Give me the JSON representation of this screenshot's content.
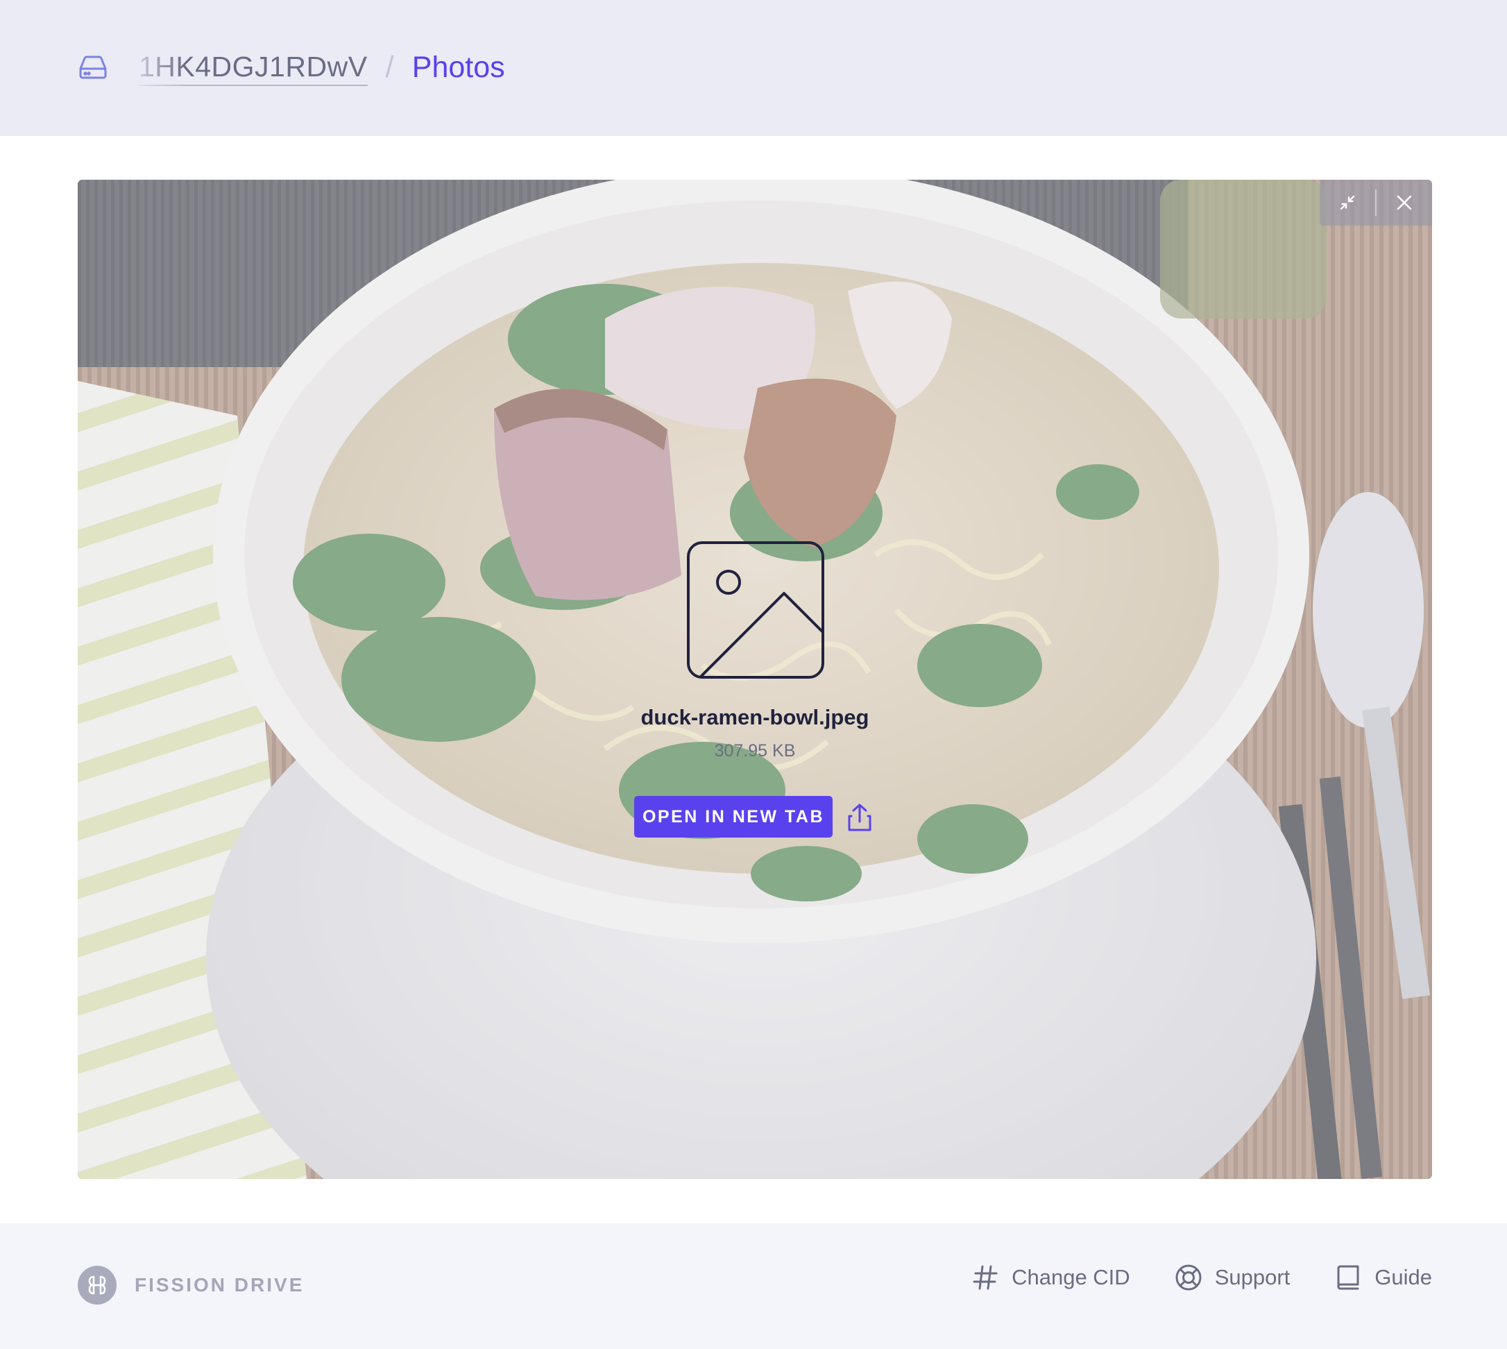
{
  "header": {
    "drive_icon": "hard-drive-icon",
    "root_label": "1HK4DGJ1RDwV",
    "separator": "/",
    "current_folder": "Photos"
  },
  "preview": {
    "image_description_icon": "image-icon",
    "file_name": "duck-ramen-bowl.jpeg",
    "file_size": "307.95 KB",
    "open_button_label": "OPEN IN NEW TAB",
    "share_icon": "share-icon",
    "minimize_icon": "minimize-icon",
    "close_icon": "close-icon"
  },
  "footer": {
    "brand_icon": "fission-logo-icon",
    "brand_name": "FISSION DRIVE",
    "nav": [
      {
        "icon": "hash-icon",
        "label": "Change CID"
      },
      {
        "icon": "lifebuoy-icon",
        "label": "Support"
      },
      {
        "icon": "book-icon",
        "label": "Guide"
      }
    ]
  },
  "colors": {
    "accent": "#5a41ee",
    "header_bg": "#eaebf4",
    "footer_bg": "#f4f5fa",
    "text_dark": "#20223d",
    "text_muted": "#6a6c82"
  }
}
